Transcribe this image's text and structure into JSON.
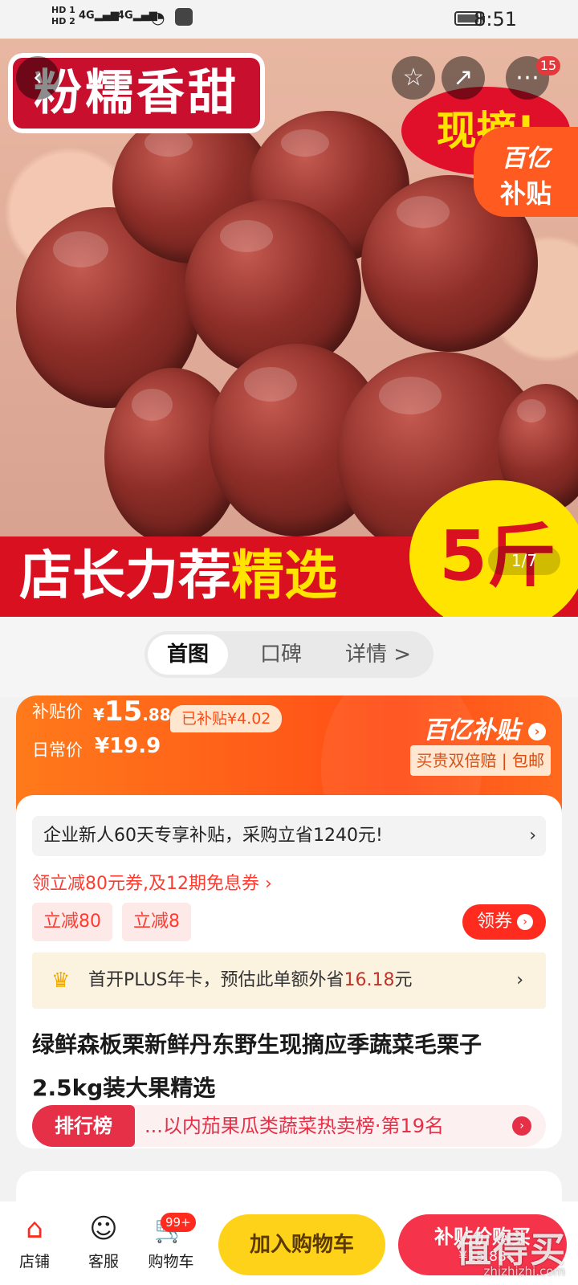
{
  "status_bar": {
    "hd1": "HD 1",
    "hd2": "HD 2",
    "net1": "4G",
    "net2": "4G",
    "time": "8:51"
  },
  "hero": {
    "top_text": "粉糯香甜",
    "red_badge": "现摘!",
    "subsidy_badge_l1": "百亿",
    "subsidy_badge_l2": "补贴",
    "bottom_text_white": "店长力荐",
    "bottom_text_yellow": "精选",
    "big_badge": "5斤",
    "pager": "1/7",
    "cart_count": "15",
    "icons": [
      "back-icon",
      "star-icon",
      "share-icon",
      "more-icon"
    ]
  },
  "tabs": [
    {
      "label": "首图",
      "active": true
    },
    {
      "label": "口碑",
      "active": false
    },
    {
      "label": "详情 >",
      "active": false
    }
  ],
  "price": {
    "subsidy_label": "补贴价",
    "currency": "¥",
    "subsidy_int": "15",
    "subsidy_dec": ".88",
    "subsidized_chip": "已补贴¥4.02",
    "daily_label": "日常价",
    "daily_price": "¥19.9",
    "program_title": "百亿补贴",
    "program_sub": "买贵双倍赔 | 包邮"
  },
  "promo": {
    "enterprise": "企业新人60天专享补贴，采购立省1240元!",
    "coupon_line": "领立减80元券,及12期免息券 ›",
    "chip1": "立减80",
    "chip2": "立减8",
    "get_coupon": "领券",
    "plus_text_pre": "首开PLUS年卡，预估此单额外省",
    "plus_amount": "16.18",
    "plus_text_post": "元"
  },
  "product": {
    "title": "绿鲜森板栗新鲜丹东野生现摘应季蔬菜毛栗子2.5kg装大果精选",
    "rank_tag": "排行榜",
    "rank_text": "...以内茄果瓜类蔬菜热卖榜·第19名"
  },
  "bottom_bar": {
    "shop": "店铺",
    "service": "客服",
    "cart": "购物车",
    "cart_badge": "99+",
    "add_to_cart": "加入购物车",
    "buy_label": "补贴价购买",
    "buy_price": "¥15.88"
  },
  "watermark": {
    "main": "值得买",
    "url": "zhizhizhi.com"
  },
  "colors": {
    "accent_red": "#ff2b1f",
    "subsidy_orange": "#ff5a1f",
    "cart_yellow": "#ffd21a",
    "buy_red": "#f5334a"
  }
}
